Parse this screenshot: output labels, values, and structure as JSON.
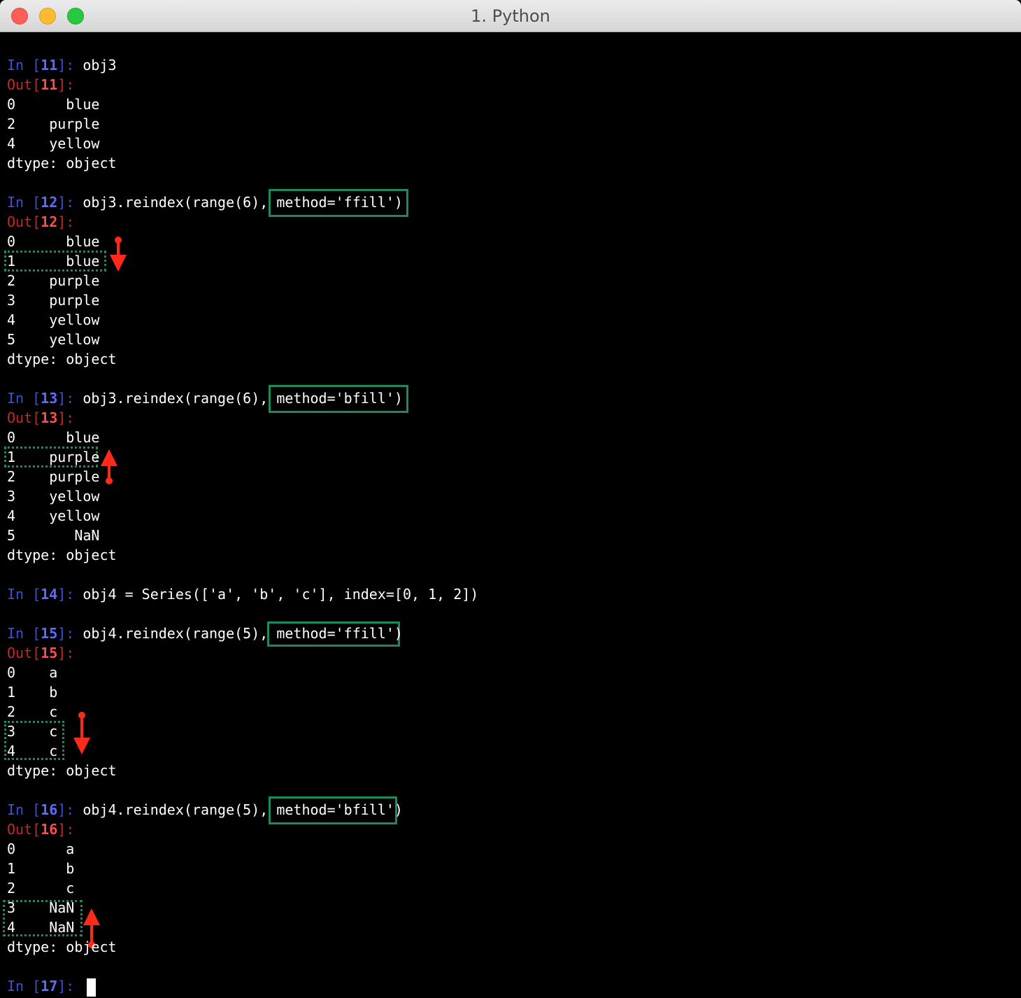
{
  "window": {
    "title": "1. Python"
  },
  "colors": {
    "in_prompt": "#3c4fd4",
    "out_prompt": "#c62828",
    "box": "#1e8a5c",
    "arrow": "#ff2a1a"
  },
  "lines": [
    {
      "in_label": "In [",
      "num": "11",
      "close": "]: ",
      "code": "obj3"
    },
    {
      "out_label": "Out[",
      "num": "11",
      "close": "]:"
    },
    {
      "text": "0      blue"
    },
    {
      "text": "2    purple"
    },
    {
      "text": "4    yellow"
    },
    {
      "text": "dtype: object"
    },
    {
      "in_label": "In [",
      "num": "12",
      "close": "]: ",
      "code": "obj3.reindex(range(6), method='ffill')"
    },
    {
      "out_label": "Out[",
      "num": "12",
      "close": "]:"
    },
    {
      "text": "0      blue"
    },
    {
      "text": "1      blue"
    },
    {
      "text": "2    purple"
    },
    {
      "text": "3    purple"
    },
    {
      "text": "4    yellow"
    },
    {
      "text": "5    yellow"
    },
    {
      "text": "dtype: object"
    },
    {
      "in_label": "In [",
      "num": "13",
      "close": "]: ",
      "code": "obj3.reindex(range(6), method='bfill')"
    },
    {
      "out_label": "Out[",
      "num": "13",
      "close": "]:"
    },
    {
      "text": "0      blue"
    },
    {
      "text": "1    purple"
    },
    {
      "text": "2    purple"
    },
    {
      "text": "3    yellow"
    },
    {
      "text": "4    yellow"
    },
    {
      "text": "5       NaN"
    },
    {
      "text": "dtype: object"
    },
    {
      "in_label": "In [",
      "num": "14",
      "close": "]: ",
      "code": "obj4 = Series(['a', 'b', 'c'], index=[0, 1, 2])"
    },
    {
      "in_label": "In [",
      "num": "15",
      "close": "]: ",
      "code": "obj4.reindex(range(5), method='ffill')"
    },
    {
      "out_label": "Out[",
      "num": "15",
      "close": "]:"
    },
    {
      "text": "0    a"
    },
    {
      "text": "1    b"
    },
    {
      "text": "2    c"
    },
    {
      "text": "3    c"
    },
    {
      "text": "4    c"
    },
    {
      "text": "dtype: object"
    },
    {
      "in_label": "In [",
      "num": "16",
      "close": "]: ",
      "code": "obj4.reindex(range(5), method='bfill')"
    },
    {
      "out_label": "Out[",
      "num": "16",
      "close": "]:"
    },
    {
      "text": "0      a"
    },
    {
      "text": "1      b"
    },
    {
      "text": "2      c"
    },
    {
      "text": "3    NaN"
    },
    {
      "text": "4    NaN"
    },
    {
      "text": "dtype: object"
    },
    {
      "in_label": "In [",
      "num": "17",
      "close": "]: ",
      "code": ""
    }
  ]
}
